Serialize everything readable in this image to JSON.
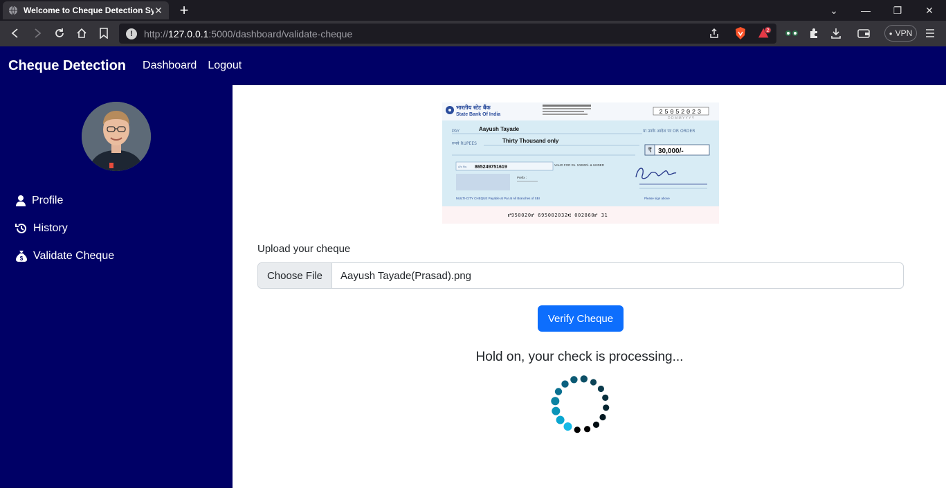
{
  "browser": {
    "tab_title": "Welcome to Cheque Detection Sy",
    "url_prefix": "http://",
    "url_host": "127.0.0.1",
    "url_rest": ":5000/dashboard/validate-cheque",
    "vpn_label": "VPN",
    "notification_count": "2"
  },
  "header": {
    "brand": "Cheque Detection",
    "nav": [
      "Dashboard",
      "Logout"
    ],
    "color": "#000066"
  },
  "sidebar": {
    "items": [
      {
        "label": "Profile",
        "icon": "person-icon"
      },
      {
        "label": "History",
        "icon": "history-icon"
      },
      {
        "label": "Validate Cheque",
        "icon": "money-bag-icon"
      }
    ]
  },
  "cheque": {
    "bank_name_hindi": "भारतीय स्टेट बैंक",
    "bank_name": "State Bank Of India",
    "date": "25052023",
    "date_hint": "D D M M Y Y Y Y",
    "pay_label": "PAY",
    "payee": "Aayush Tayade",
    "or_order": "या उनके आदेश पर OR ORDER",
    "rupees_label": "रुपये RUPEES",
    "amount_words": "Thirty Thousand only",
    "rupee_symbol": "₹",
    "amount": "30,000/-",
    "account_label": "A/c No.",
    "account_number": "865249751619",
    "valid_for": "VALID FOR Rs. 100000/- & UNDER",
    "prefix": "Prefix :",
    "multicity": "MULTI-CITY CHEQUE Payable at Par at All Branches of SBI",
    "sign_hint": "Please sign above",
    "micr": "⑈950020⑈ 695002032⑆ 002860⑈ 31"
  },
  "form": {
    "upload_label": "Upload your cheque",
    "choose_file": "Choose File",
    "file_name": "Aayush Tayade(Prasad).png",
    "verify_button": "Verify Cheque",
    "verify_color": "#0d6efd"
  },
  "status": {
    "processing_text": "Hold on, your check is processing..."
  }
}
